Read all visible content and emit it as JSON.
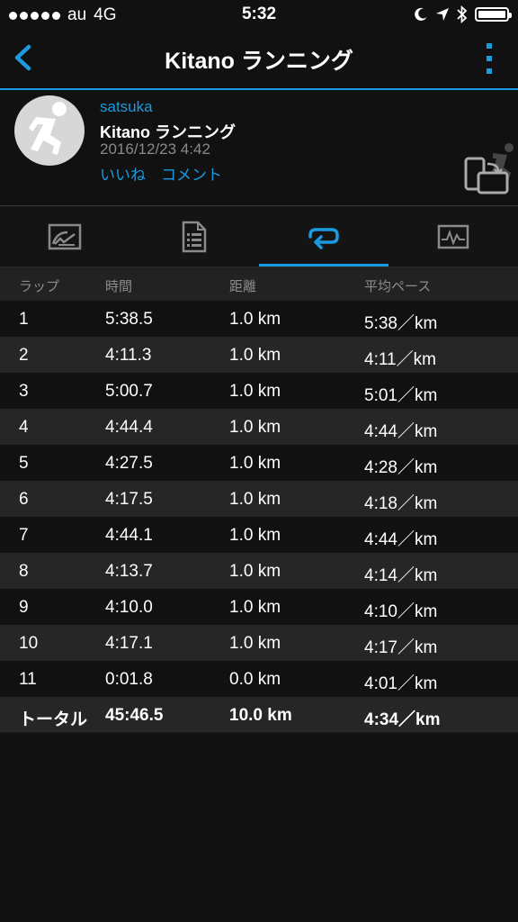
{
  "status_bar": {
    "carrier": "au",
    "network": "4G",
    "time": "5:32"
  },
  "nav": {
    "title": "Kitano ランニング"
  },
  "activity": {
    "user": "satsuka",
    "name": "Kitano ランニング",
    "date": "2016/12/23 4:42",
    "like_label": "いいね",
    "comment_label": "コメント"
  },
  "tabs": [
    {
      "icon": "chart-summary-icon",
      "active": false
    },
    {
      "icon": "document-details-icon",
      "active": false
    },
    {
      "icon": "laps-loop-icon",
      "active": true
    },
    {
      "icon": "graph-monitor-icon",
      "active": false
    }
  ],
  "table": {
    "headers": [
      "ラップ",
      "時間",
      "距離",
      "平均ペース"
    ],
    "rows": [
      [
        "1",
        "5:38.5",
        "1.0 km",
        "5:38／km"
      ],
      [
        "2",
        "4:11.3",
        "1.0 km",
        "4:11／km"
      ],
      [
        "3",
        "5:00.7",
        "1.0 km",
        "5:01／km"
      ],
      [
        "4",
        "4:44.4",
        "1.0 km",
        "4:44／km"
      ],
      [
        "5",
        "4:27.5",
        "1.0 km",
        "4:28／km"
      ],
      [
        "6",
        "4:17.5",
        "1.0 km",
        "4:18／km"
      ],
      [
        "7",
        "4:44.1",
        "1.0 km",
        "4:44／km"
      ],
      [
        "8",
        "4:13.7",
        "1.0 km",
        "4:14／km"
      ],
      [
        "9",
        "4:10.0",
        "1.0 km",
        "4:10／km"
      ],
      [
        "10",
        "4:17.1",
        "1.0 km",
        "4:17／km"
      ],
      [
        "11",
        "0:01.8",
        "0.0 km",
        "4:01／km"
      ]
    ],
    "total": [
      "トータル",
      "45:46.5",
      "10.0 km",
      "4:34／km"
    ]
  },
  "colors": {
    "accent": "#1a9be0",
    "background": "#111111",
    "row_alt": "#262626"
  }
}
